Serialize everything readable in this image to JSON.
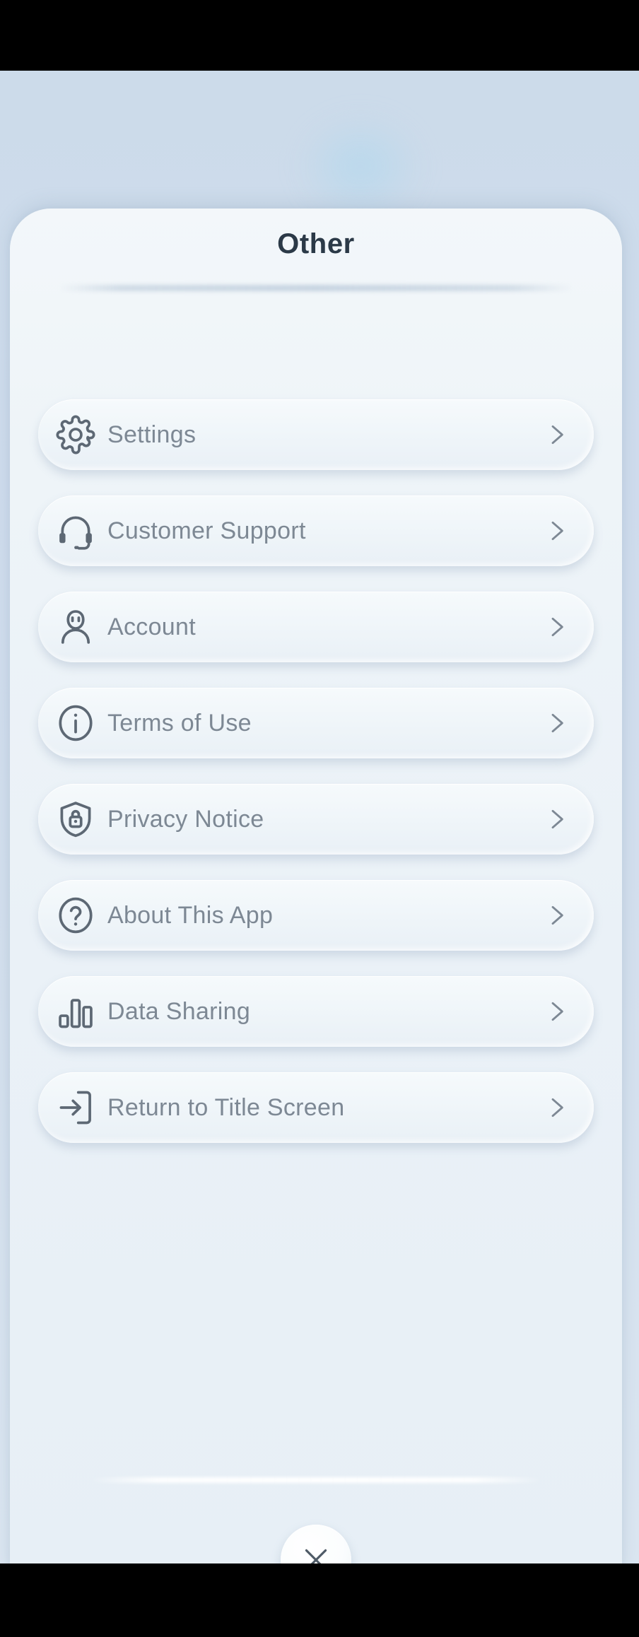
{
  "screen": {
    "title": "Other",
    "close_label": "close"
  },
  "menu": {
    "items": [
      {
        "label": "Settings",
        "icon": "gear-icon"
      },
      {
        "label": "Customer Support",
        "icon": "headset-icon"
      },
      {
        "label": "Account",
        "icon": "person-icon"
      },
      {
        "label": "Terms of Use",
        "icon": "info-circle-icon"
      },
      {
        "label": "Privacy Notice",
        "icon": "shield-lock-icon"
      },
      {
        "label": "About This App",
        "icon": "question-circle-icon"
      },
      {
        "label": "Data Sharing",
        "icon": "bar-chart-icon"
      },
      {
        "label": "Return to Title Screen",
        "icon": "exit-arrow-icon"
      }
    ]
  },
  "colors": {
    "background": "#ccdbea",
    "card": "#eef4f8",
    "title_text": "#2b3947",
    "label_text": "#7d8894",
    "icon": "#5d6874",
    "chevron": "#7d8894",
    "letterbox": "#000000"
  }
}
